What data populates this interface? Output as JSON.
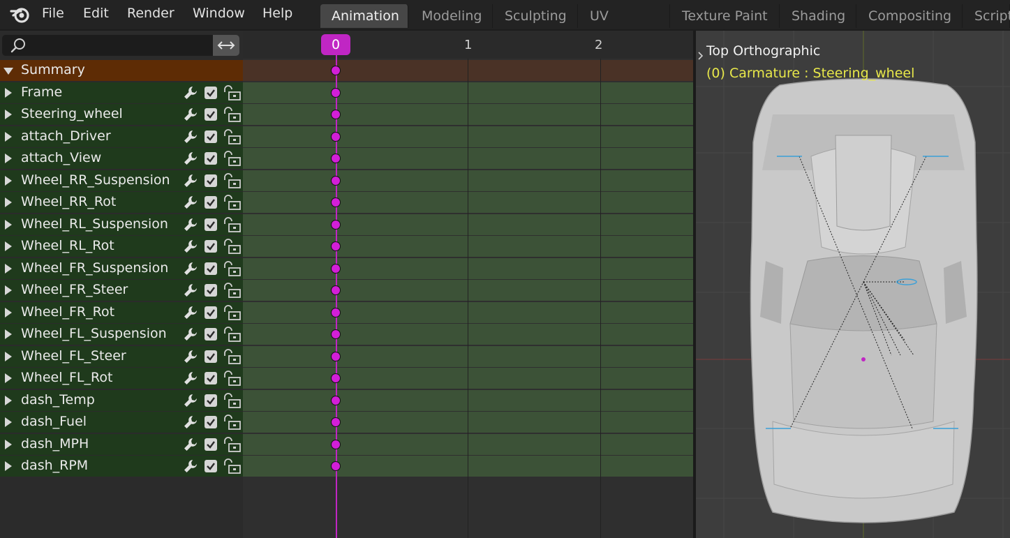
{
  "menu": [
    "File",
    "Edit",
    "Render",
    "Window",
    "Help"
  ],
  "workspaces": {
    "active": "Animation",
    "tabs": [
      "Animation",
      "Modeling",
      "Sculpting",
      "UV Editing",
      "Texture Paint",
      "Shading",
      "Compositing",
      "Script"
    ]
  },
  "channels": {
    "summary": "Summary",
    "items": [
      "Frame",
      "Steering_wheel",
      "attach_Driver",
      "attach_View",
      "Wheel_RR_Suspension",
      "Wheel_RR_Rot",
      "Wheel_RL_Suspension",
      "Wheel_RL_Rot",
      "Wheel_FR_Suspension",
      "Wheel_FR_Steer",
      "Wheel_FR_Rot",
      "Wheel_FL_Suspension",
      "Wheel_FL_Steer",
      "Wheel_FL_Rot",
      "dash_Temp",
      "dash_Fuel",
      "dash_MPH",
      "dash_RPM"
    ]
  },
  "timeline": {
    "current_frame": "0",
    "frame_labels": [
      "1",
      "2"
    ]
  },
  "viewport": {
    "title": "Top Orthographic",
    "subtitle": "(0) Carmature : Steering_wheel"
  },
  "colors": {
    "accent": "#c026c4",
    "channel_bg": "#1f3a1c",
    "summary_bg": "#5e2c05",
    "viewport_text_highlight": "#e8e84a"
  }
}
